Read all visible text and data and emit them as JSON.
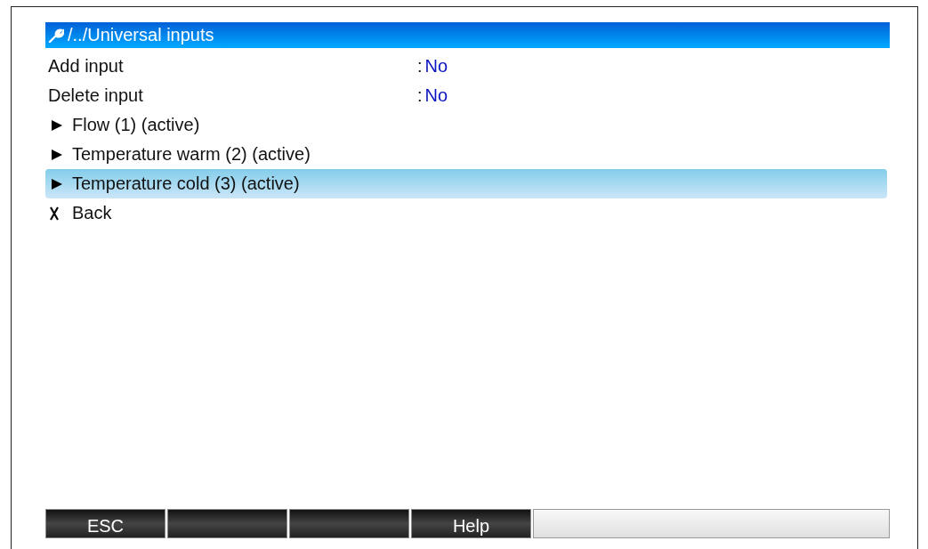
{
  "header": {
    "path": "/../Universal inputs"
  },
  "items": [
    {
      "kind": "setting",
      "label": "Add input",
      "separator": ":",
      "value": "No",
      "selected": false
    },
    {
      "kind": "setting",
      "label": "Delete input",
      "separator": ":",
      "value": "No",
      "selected": false
    },
    {
      "kind": "submenu",
      "label": "Flow (1) (active)",
      "selected": false
    },
    {
      "kind": "submenu",
      "label": "Temperature warm (2) (active)",
      "selected": false
    },
    {
      "kind": "submenu",
      "label": "Temperature cold (3) (active)",
      "selected": true
    },
    {
      "kind": "back",
      "label": "Back",
      "selected": false
    }
  ],
  "softkeys": [
    {
      "kind": "key",
      "label": "ESC"
    },
    {
      "kind": "key"
    },
    {
      "kind": "key"
    },
    {
      "kind": "key",
      "label": "Help"
    },
    {
      "kind": "field"
    }
  ]
}
